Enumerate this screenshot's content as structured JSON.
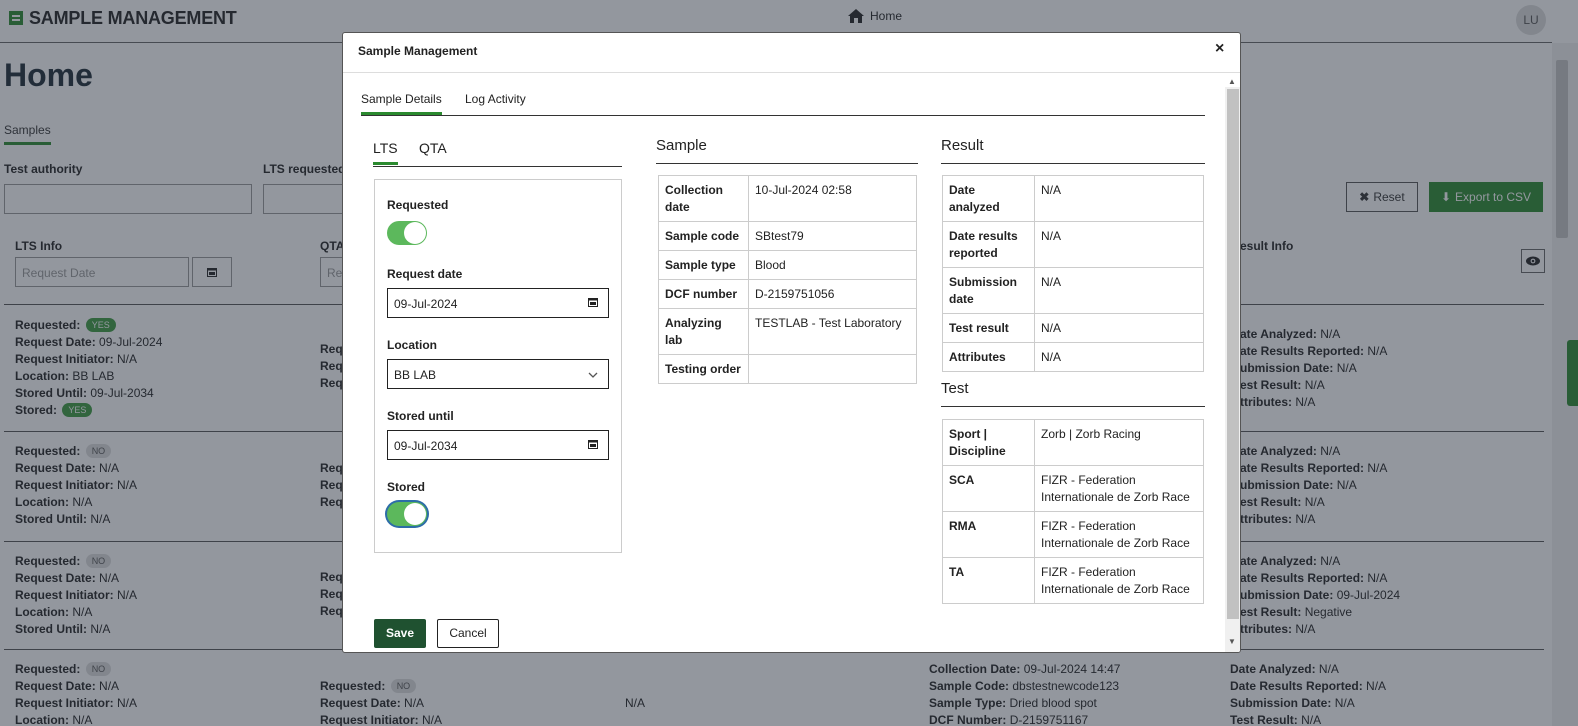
{
  "app": {
    "title": "SAMPLE MANAGEMENT",
    "nav_home": "Home",
    "avatar_initials": "LU"
  },
  "page": {
    "title": "Home",
    "tab": "Samples"
  },
  "filters": {
    "test_authority_label": "Test authority",
    "lts_requested_label": "LTS requested",
    "reset_label": "Reset",
    "export_label": "Export to CSV"
  },
  "columns": {
    "lts_info": "LTS Info",
    "qta_prefix": "QTA",
    "result_info": "esult Info",
    "request_date_placeholder": "Request Date",
    "qta_placeholder": "Rec"
  },
  "rows": [
    {
      "lts": {
        "requested_label": "Requested:",
        "requested": "YES",
        "request_date_label": "Request Date:",
        "request_date": "09-Jul-2024",
        "initiator_label": "Request Initiator:",
        "initiator": "N/A",
        "location_label": "Location:",
        "location": "BB LAB",
        "stored_until_label": "Stored Until:",
        "stored_until": "09-Jul-2034",
        "stored_label": "Stored:",
        "stored": "YES"
      },
      "qta_stub": [
        "Requ",
        "Requ",
        "Requ"
      ],
      "result": {
        "date_analyzed_label": "ate Analyzed:",
        "date_analyzed": "N/A",
        "results_reported_label": "ate Results Reported:",
        "results_reported": "N/A",
        "submission_label": "ubmission Date:",
        "submission": "N/A",
        "test_result_label": "est Result:",
        "test_result": "N/A",
        "attributes_label": "ttributes:",
        "attributes": "N/A"
      }
    },
    {
      "lts": {
        "requested_label": "Requested:",
        "requested": "NO",
        "request_date_label": "Request Date:",
        "request_date": "N/A",
        "initiator_label": "Request Initiator:",
        "initiator": "N/A",
        "location_label": "Location:",
        "location": "N/A",
        "stored_until_label": "Stored Until:",
        "stored_until": "N/A"
      },
      "qta_stub": [
        "Requ",
        "Requ",
        "Requ"
      ],
      "result": {
        "date_analyzed_label": "ate Analyzed:",
        "date_analyzed": "N/A",
        "results_reported_label": "ate Results Reported:",
        "results_reported": "N/A",
        "submission_label": "ubmission Date:",
        "submission": "N/A",
        "test_result_label": "est Result:",
        "test_result": "N/A",
        "attributes_label": "ttributes:",
        "attributes": "N/A"
      }
    },
    {
      "lts": {
        "requested_label": "Requested:",
        "requested": "NO",
        "request_date_label": "Request Date:",
        "request_date": "N/A",
        "initiator_label": "Request Initiator:",
        "initiator": "N/A",
        "location_label": "Location:",
        "location": "N/A",
        "stored_until_label": "Stored Until:",
        "stored_until": "N/A"
      },
      "qta_stub": [
        "Requ",
        "Requ",
        "Requ"
      ],
      "result": {
        "date_analyzed_label": "ate Analyzed:",
        "date_analyzed": "N/A",
        "results_reported_label": "ate Results Reported:",
        "results_reported": "N/A",
        "submission_label": "ubmission Date:",
        "submission": "09-Jul-2024",
        "test_result_label": "est Result:",
        "test_result": "Negative",
        "attributes_label": "ttributes:",
        "attributes": "N/A"
      }
    },
    {
      "lts": {
        "requested_label": "Requested:",
        "requested": "NO",
        "request_date_label": "Request Date:",
        "request_date": "N/A",
        "initiator_label": "Request Initiator:",
        "initiator": "N/A",
        "location_label": "Location:",
        "location": "N/A"
      },
      "qta": {
        "requested_label": "Requested:",
        "requested": "NO",
        "request_date_label": "Request Date:",
        "request_date": "N/A",
        "initiator_label": "Request Initiator:",
        "initiator": "N/A"
      },
      "mid_value": "N/A",
      "sample": {
        "collection_label": "Collection Date:",
        "collection": "09-Jul-2024 14:47",
        "code_label": "Sample Code:",
        "code": "dbstestnewcode123",
        "type_label": "Sample Type:",
        "type": "Dried blood spot",
        "dcf_label": "DCF Number:",
        "dcf": "D-2159751167"
      },
      "result": {
        "date_analyzed_label": "Date Analyzed:",
        "date_analyzed": "N/A",
        "results_reported_label": "Date Results Reported:",
        "results_reported": "N/A",
        "submission_label": "Submission Date:",
        "submission": "N/A",
        "test_result_label": "Test Result:",
        "test_result": "N/A"
      }
    }
  ],
  "modal": {
    "title": "Sample Management",
    "close": "×",
    "tabs": [
      "Sample Details",
      "Log Activity"
    ],
    "subtabs": [
      "LTS",
      "QTA"
    ],
    "lts": {
      "requested_label": "Requested",
      "requested": true,
      "request_date_label": "Request date",
      "request_date": "09-Jul-2024",
      "location_label": "Location",
      "location": "BB LAB",
      "stored_until_label": "Stored until",
      "stored_until": "09-Jul-2034",
      "stored_label": "Stored",
      "stored": true
    },
    "sample": {
      "title": "Sample",
      "rows": [
        {
          "k": "Collection date",
          "v": "10-Jul-2024 02:58"
        },
        {
          "k": "Sample code",
          "v": "SBtest79"
        },
        {
          "k": "Sample type",
          "v": "Blood"
        },
        {
          "k": "DCF number",
          "v": "D-2159751056"
        },
        {
          "k": "Analyzing lab",
          "v": "TESTLAB - Test Laboratory"
        },
        {
          "k": "Testing order",
          "v": ""
        }
      ]
    },
    "result": {
      "title": "Result",
      "rows": [
        {
          "k": "Date analyzed",
          "v": "N/A"
        },
        {
          "k": "Date results reported",
          "v": "N/A"
        },
        {
          "k": "Submission date",
          "v": "N/A"
        },
        {
          "k": "Test result",
          "v": "N/A"
        },
        {
          "k": "Attributes",
          "v": "N/A"
        }
      ]
    },
    "test": {
      "title": "Test",
      "rows": [
        {
          "k": "Sport | Discipline",
          "v": "Zorb | Zorb Racing"
        },
        {
          "k": "SCA",
          "v": "FIZR - Federation Internationale de Zorb Race"
        },
        {
          "k": "RMA",
          "v": "FIZR - Federation Internationale de Zorb Race"
        },
        {
          "k": "TA",
          "v": "FIZR - Federation Internationale de Zorb Race"
        }
      ]
    },
    "save_label": "Save",
    "cancel_label": "Cancel"
  },
  "colors": {
    "brand_green": "#2b8a2f",
    "save_dark_green": "#1f5130",
    "toggle_on": "#5cb85c",
    "overlay": "rgba(40,48,62,0.5)"
  }
}
